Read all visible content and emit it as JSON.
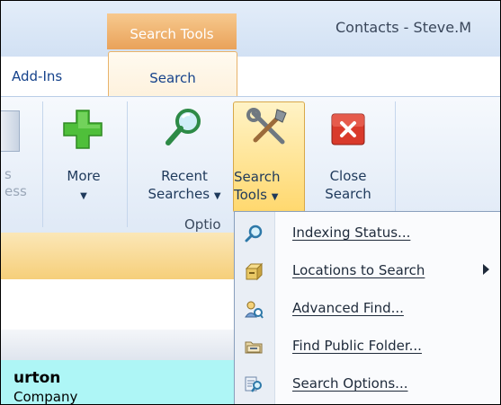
{
  "window": {
    "title": "Contacts - Steve.M",
    "contextual_group": "Search Tools"
  },
  "tabs": [
    {
      "label": "Add-Ins"
    },
    {
      "label": "Search"
    }
  ],
  "ribbon": {
    "more_label": "More",
    "recent_line1": "Recent",
    "recent_line2": "Searches",
    "search_tools_line1": "Search",
    "search_tools_line2": "Tools",
    "close_line1": "Close",
    "close_line2": "Search",
    "group_label": "Optio",
    "partial_line1": "s",
    "partial_line2": "ess"
  },
  "menu": {
    "items": [
      {
        "label": "Indexing Status...",
        "icon": "magnifier-icon"
      },
      {
        "label": "Locations to Search",
        "icon": "cabinet-icon",
        "submenu": true
      },
      {
        "label": "Advanced Find...",
        "icon": "advanced-find-icon"
      },
      {
        "label": "Find Public Folder...",
        "icon": "folder-find-icon"
      },
      {
        "label": "Search Options...",
        "icon": "search-options-icon"
      }
    ]
  },
  "contact": {
    "name": "urton",
    "company": "Company"
  },
  "colors": {
    "contextual_orange": "#e9a25a",
    "highlight": "#ffd86e",
    "contact_card": "#aef6f6",
    "close_red": "#d93a2b",
    "plus_green": "#4fbf3a"
  }
}
